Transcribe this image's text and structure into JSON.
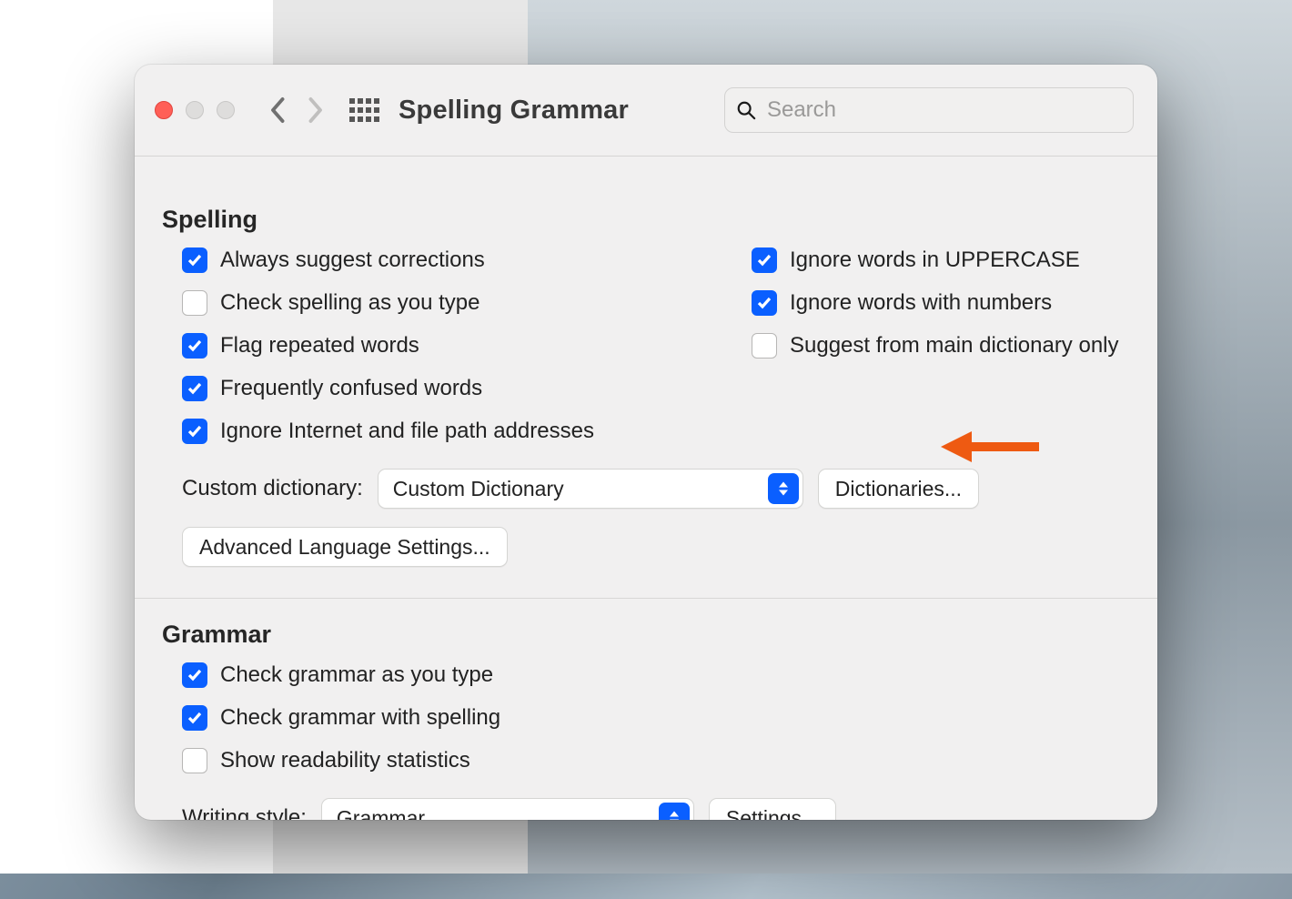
{
  "toolbar": {
    "title": "Spelling  Grammar",
    "search_placeholder": "Search"
  },
  "spelling": {
    "heading": "Spelling",
    "options_left": [
      {
        "label": "Always suggest corrections",
        "checked": true
      },
      {
        "label": "Check spelling as you type",
        "checked": false
      },
      {
        "label": "Flag repeated words",
        "checked": true
      },
      {
        "label": "Frequently confused words",
        "checked": true
      },
      {
        "label": "Ignore Internet and file path addresses",
        "checked": true
      }
    ],
    "options_right": [
      {
        "label": "Ignore words in UPPERCASE",
        "checked": true
      },
      {
        "label": "Ignore words with numbers",
        "checked": true
      },
      {
        "label": "Suggest from main dictionary only",
        "checked": false
      }
    ],
    "custom_dict_label": "Custom dictionary:",
    "custom_dict_value": "Custom Dictionary",
    "dictionaries_button": "Dictionaries...",
    "advanced_button": "Advanced Language Settings..."
  },
  "grammar": {
    "heading": "Grammar",
    "options": [
      {
        "label": "Check grammar as you type",
        "checked": true
      },
      {
        "label": "Check grammar with spelling",
        "checked": true
      },
      {
        "label": "Show readability statistics",
        "checked": false
      }
    ],
    "writing_style_label": "Writing style:",
    "writing_style_value": "Grammar",
    "settings_button": "Settings..."
  }
}
